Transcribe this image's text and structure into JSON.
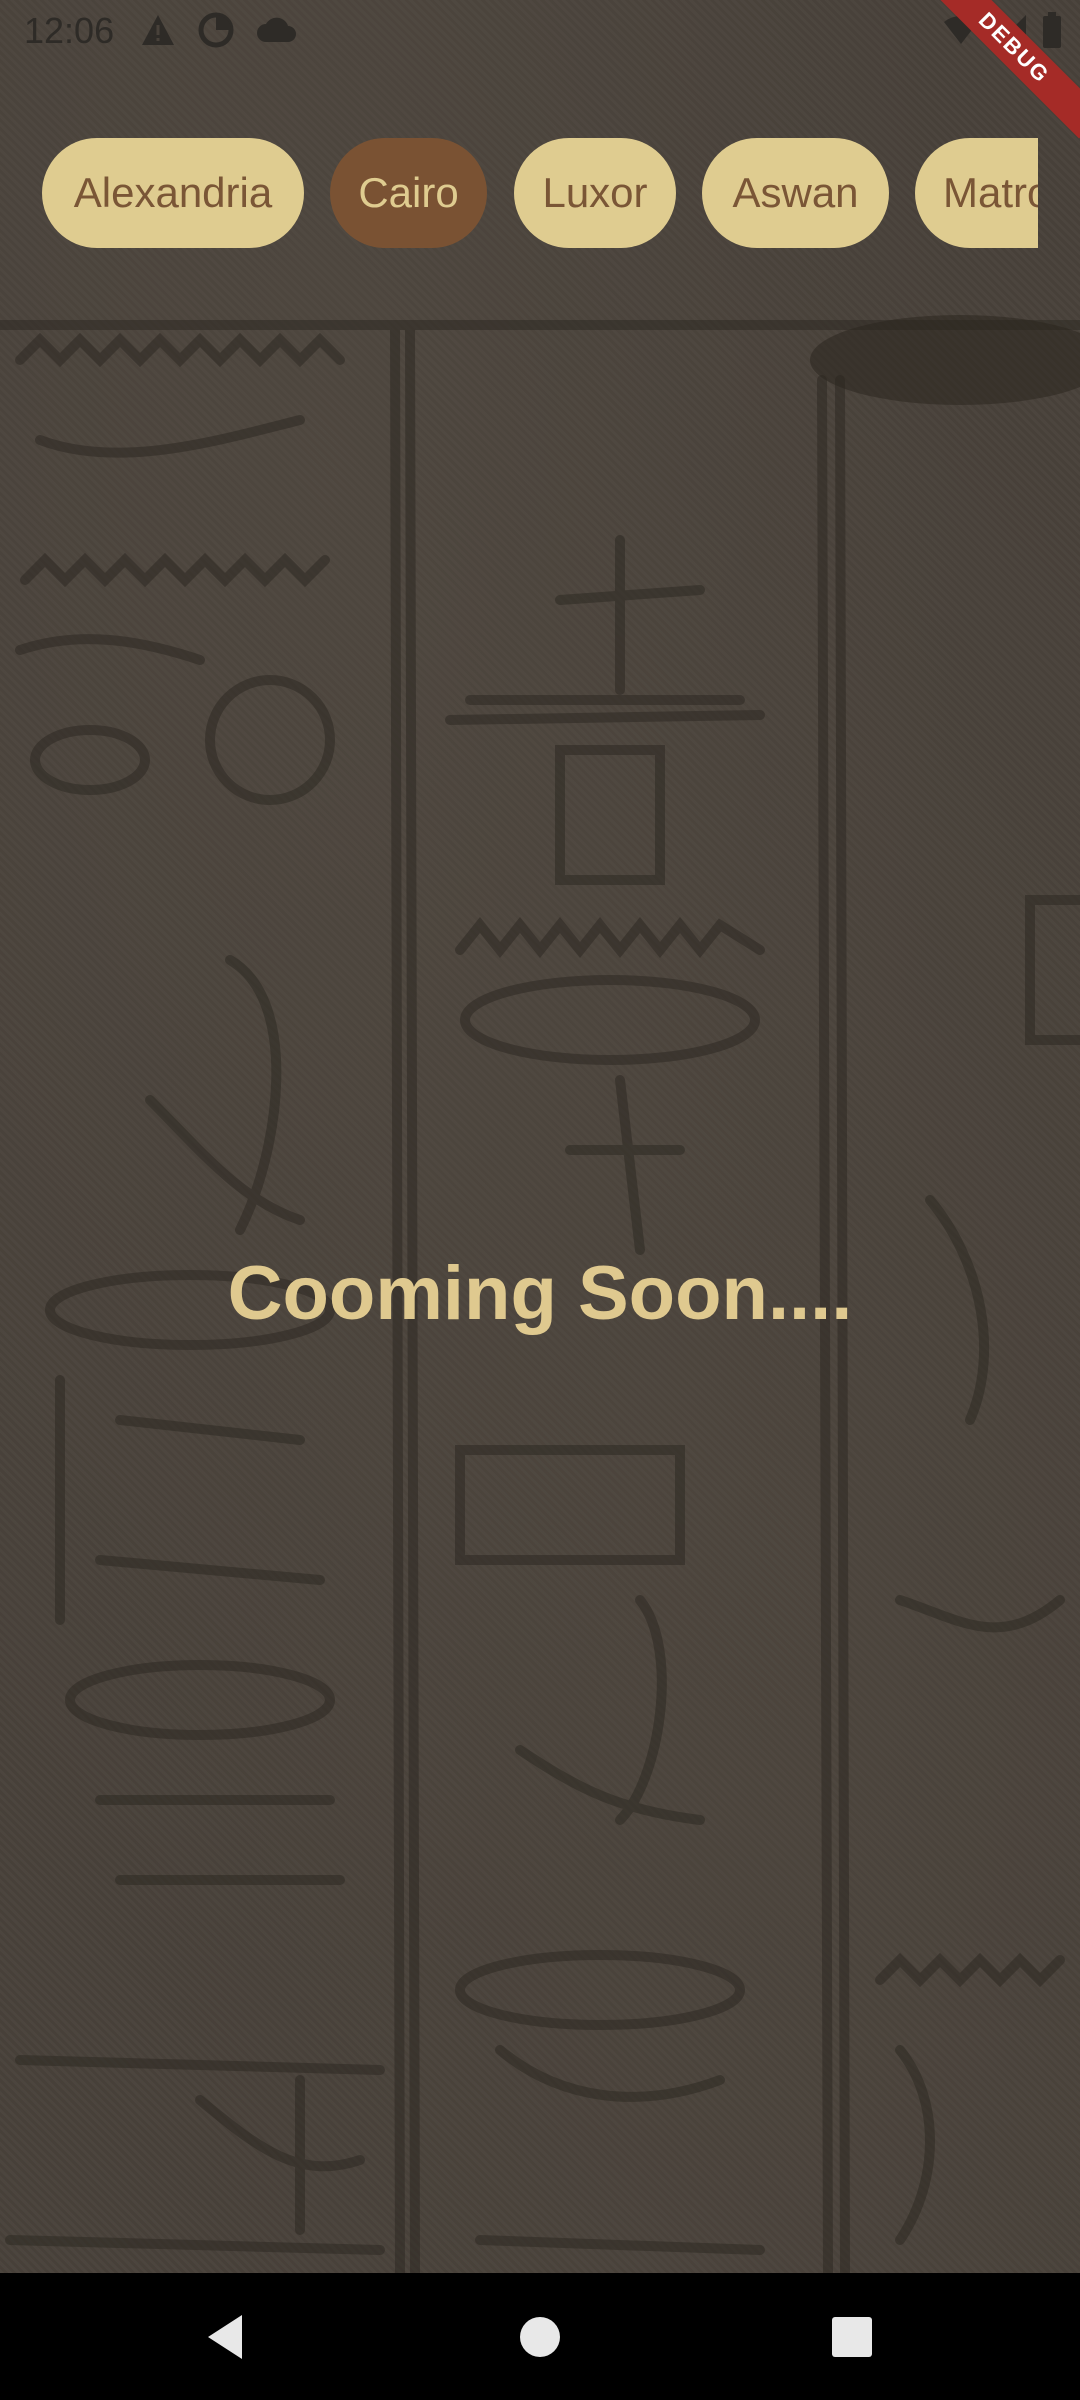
{
  "status_bar": {
    "time": "12:06",
    "icons_left": [
      "warning-icon",
      "data-saver-icon",
      "cloud-icon"
    ],
    "icons_right": [
      "wifi-icon",
      "signal-icon",
      "battery-icon"
    ],
    "debug_label": "DEBUG"
  },
  "cities": {
    "items": [
      {
        "label": "Alexandria",
        "selected": false
      },
      {
        "label": "Cairo",
        "selected": true
      },
      {
        "label": "Luxor",
        "selected": false
      },
      {
        "label": "Aswan",
        "selected": false
      },
      {
        "label": "Matrouh",
        "selected": false
      }
    ],
    "selected_color": "#7a5233",
    "chip_color": "#dfcc90"
  },
  "main": {
    "message": "Cooming Soon...."
  },
  "nav_bar": {
    "buttons": [
      "back-icon",
      "home-icon",
      "recents-icon"
    ]
  }
}
